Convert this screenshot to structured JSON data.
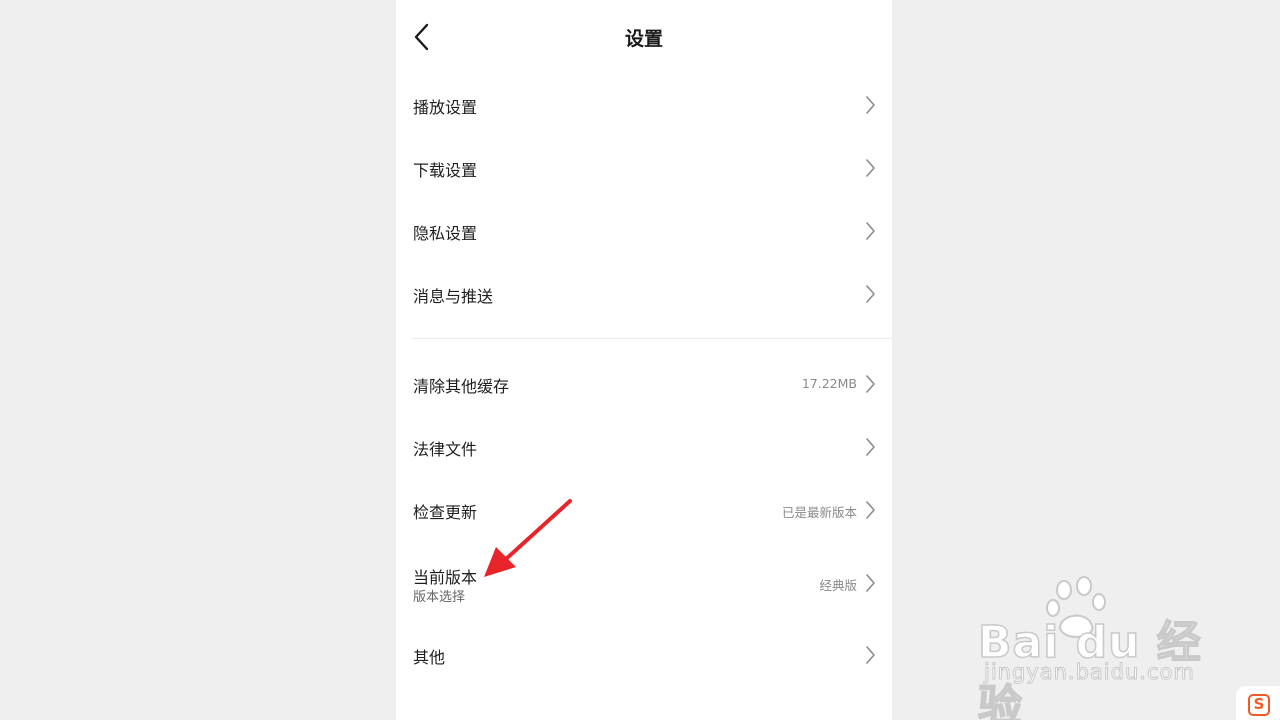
{
  "header": {
    "title": "设置"
  },
  "rows": [
    {
      "label": "播放设置",
      "value": "",
      "sub": ""
    },
    {
      "label": "下载设置",
      "value": "",
      "sub": ""
    },
    {
      "label": "隐私设置",
      "value": "",
      "sub": ""
    },
    {
      "label": "消息与推送",
      "value": "",
      "sub": ""
    },
    {
      "label": "清除其他缓存",
      "value": "17.22MB",
      "sub": ""
    },
    {
      "label": "法律文件",
      "value": "",
      "sub": ""
    },
    {
      "label": "检查更新",
      "value": "已是最新版本",
      "sub": ""
    },
    {
      "label": "当前版本",
      "value": "经典版",
      "sub": "版本选择"
    },
    {
      "label": "其他",
      "value": "",
      "sub": ""
    }
  ],
  "watermark": {
    "brand": "Bai du 经验",
    "url": "jingyan.baidu.com"
  },
  "corner_logo": {
    "letter": "S"
  },
  "colors": {
    "annotation_arrow": "#e8242b",
    "corner_logo": "#f05a23"
  },
  "icons": {
    "back": "chevron-left-icon",
    "row": "chevron-right-icon"
  }
}
